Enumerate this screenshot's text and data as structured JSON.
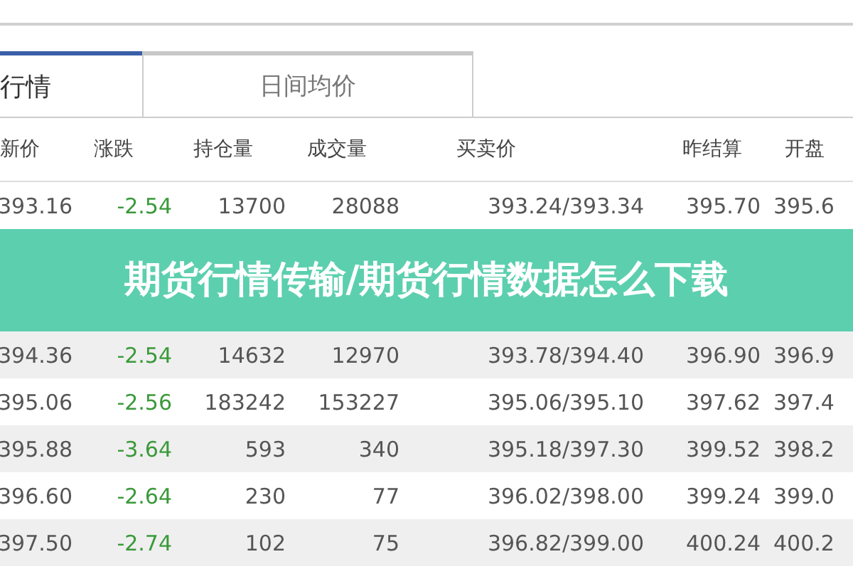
{
  "tabs": [
    {
      "label": "行情",
      "selected": true
    },
    {
      "label": "日间均价",
      "selected": false
    }
  ],
  "table": {
    "columns": [
      "新价",
      "涨跌",
      "持仓量",
      "成交量",
      "买卖价",
      "昨结算",
      "开盘"
    ],
    "rows": [
      {
        "cells": [
          "393.16",
          "-2.54",
          "13700",
          "28088",
          "393.24/393.34",
          "395.70",
          "395.6"
        ]
      },
      {
        "cells": [
          "394.36",
          "-2.54",
          "14632",
          "12970",
          "393.78/394.40",
          "396.90",
          "396.9"
        ]
      },
      {
        "cells": [
          "395.06",
          "-2.56",
          "183242",
          "153227",
          "395.06/395.10",
          "397.62",
          "397.4"
        ]
      },
      {
        "cells": [
          "395.88",
          "-3.64",
          "593",
          "340",
          "395.18/397.30",
          "399.52",
          "398.2"
        ]
      },
      {
        "cells": [
          "396.60",
          "-2.64",
          "230",
          "77",
          "396.02/398.00",
          "399.24",
          "399.0"
        ]
      },
      {
        "cells": [
          "397.50",
          "-2.74",
          "102",
          "75",
          "396.82/399.00",
          "400.24",
          "400.2"
        ]
      }
    ]
  },
  "banner": {
    "title": "期货行情传输/期货行情数据怎么下载"
  }
}
